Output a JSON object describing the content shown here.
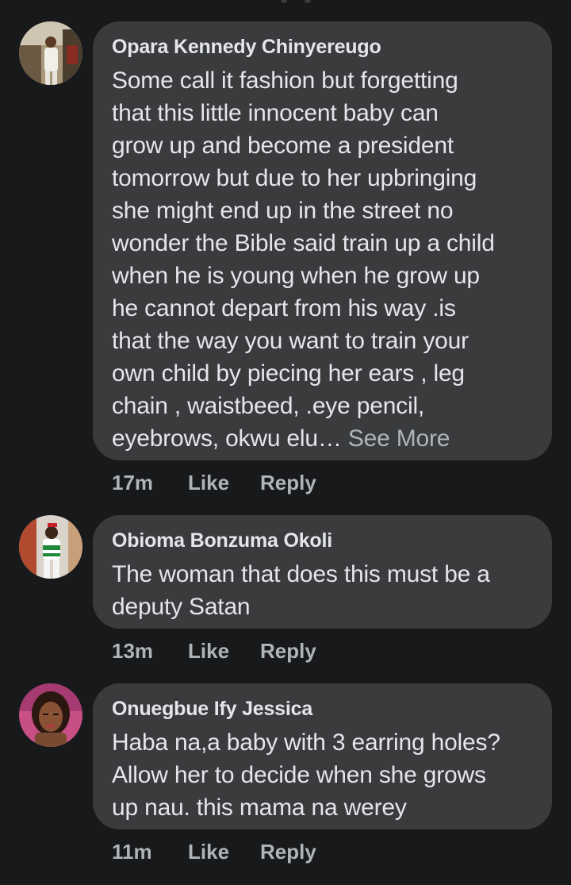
{
  "comments": [
    {
      "author": "Opara Kennedy Chinyereugo",
      "text": "Some call it fashion but forgetting\nthat this little innocent  baby can\ngrow up and become a president\ntomorrow but due to her upbringing\nshe might end up in the street no\nwonder the Bible said train up a child\nwhen he is young when he grow up\nhe cannot depart from his way .is\nthat the way you want to train your\nown child by piecing her ears , leg\nchain , waistbeed, .eye pencil,\neyebrows, okwu elu… ",
      "see_more": "See More",
      "time": "17m",
      "like": "Like",
      "reply": "Reply",
      "avatar_icon": "user-photo-man-standing"
    },
    {
      "author": "Obioma Bonzuma Okoli",
      "text": "The woman  that does this must be a\ndeputy Satan",
      "time": "13m",
      "like": "Like",
      "reply": "Reply",
      "avatar_icon": "user-photo-man-green-shirt"
    },
    {
      "author": "Onuegbue Ify Jessica",
      "text": "Haba na,a baby with 3 earring holes?\nAllow her to decide when she grows\nup nau. this mama na werey",
      "time": "11m",
      "like": "Like",
      "reply": "Reply",
      "avatar_icon": "user-photo-woman"
    }
  ],
  "colors": {
    "background": "#18191b",
    "bubble": "#3a3b3c",
    "text": "#e4e6eb",
    "secondary": "#b0b3b8"
  }
}
